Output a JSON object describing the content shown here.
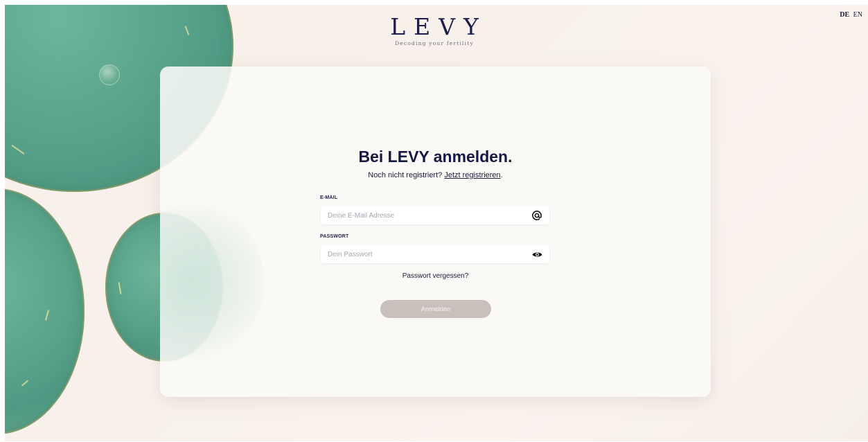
{
  "language_switch": {
    "active": "DE",
    "other": "EN"
  },
  "brand": {
    "logo_text": "LEVY",
    "tagline": "Decoding your fertility"
  },
  "login": {
    "title": "Bei LEVY anmelden.",
    "register_prompt": "Noch nicht registriert?",
    "register_link": "Jetzt registrieren",
    "register_suffix": ".",
    "email": {
      "label": "E-MAIL",
      "placeholder": "Deine E-Mail Adresse",
      "value": "",
      "icon": "at-sign-icon"
    },
    "password": {
      "label": "PASSWORT",
      "placeholder": "Dein Passwort",
      "value": "",
      "icon": "eye-icon"
    },
    "forgot_password": "Passwort vergessen?",
    "submit_label": "Anmelden"
  },
  "colors": {
    "brand_navy": "#1d1f4a",
    "submit_disabled": "#c9c0bc",
    "accent_green": "#5aa48c",
    "background": "#f8f1eb"
  }
}
